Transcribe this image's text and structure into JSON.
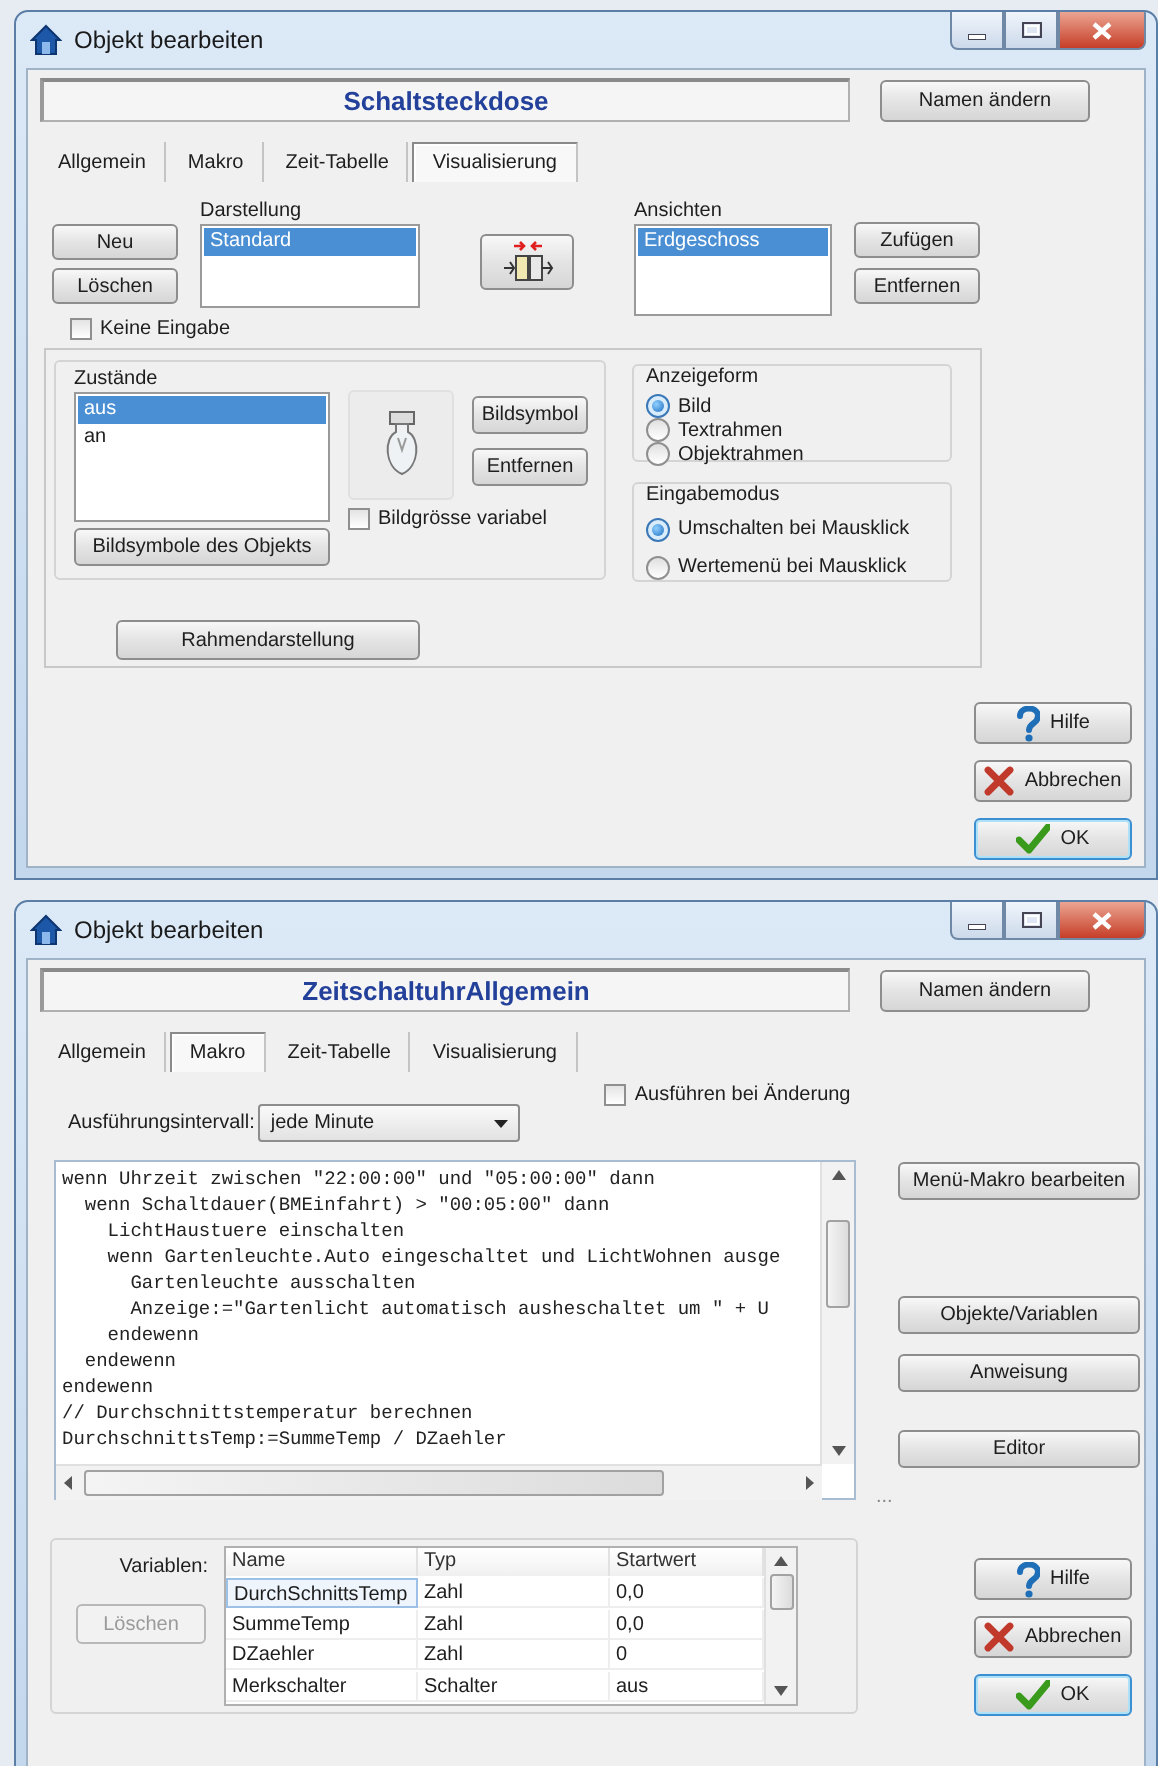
{
  "windows": [
    {
      "kind": "visualisierung",
      "title": "Objekt bearbeiten",
      "object_name": "Schaltsteckdose",
      "rename_button": "Namen ändern",
      "tabs": [
        {
          "label": "Allgemein",
          "selected": false
        },
        {
          "label": "Makro",
          "selected": false
        },
        {
          "label": "Zeit-Tabelle",
          "selected": false
        },
        {
          "label": "Visualisierung",
          "selected": true
        }
      ],
      "list_buttons": [
        "Neu",
        "Löschen"
      ],
      "darstellung": {
        "label": "Darstellung",
        "items": [
          {
            "text": "Standard",
            "selected": true
          }
        ]
      },
      "ansichten": {
        "label": "Ansichten",
        "items": [
          {
            "text": "Erdgeschoss",
            "selected": true
          }
        ]
      },
      "view_buttons": [
        "Zufügen",
        "Entfernen"
      ],
      "no_input": {
        "label": "Keine Eingabe",
        "checked": false
      },
      "states": {
        "label": "Zustände",
        "items": [
          {
            "text": "aus",
            "selected": true
          },
          {
            "text": "an",
            "selected": false
          }
        ],
        "buttons": [
          "Bildsymbol",
          "Entfernen"
        ],
        "variable_size": {
          "label": "Bildgrösse variabel",
          "checked": false
        },
        "object_icons_button": "Bildsymbole des Objekts"
      },
      "display_form": {
        "label": "Anzeigeform",
        "options": [
          {
            "label": "Bild",
            "selected": true
          },
          {
            "label": "Textrahmen",
            "selected": false
          },
          {
            "label": "Objektrahmen",
            "selected": false
          }
        ]
      },
      "input_mode": {
        "label": "Eingabemodus",
        "options": [
          {
            "label": "Umschalten bei Mausklick",
            "selected": true
          },
          {
            "label": "Wertemenü bei Mausklick",
            "selected": false
          }
        ]
      },
      "frame_button": "Rahmendarstellung",
      "footer_buttons": [
        {
          "kind": "help",
          "label": "Hilfe"
        },
        {
          "kind": "cancel",
          "label": "Abbrechen"
        },
        {
          "kind": "ok",
          "label": "OK"
        }
      ]
    },
    {
      "kind": "makro",
      "title": "Objekt bearbeiten",
      "object_name": "ZeitschaltuhrAllgemein",
      "rename_button": "Namen ändern",
      "tabs": [
        {
          "label": "Allgemein",
          "selected": false
        },
        {
          "label": "Makro",
          "selected": true
        },
        {
          "label": "Zeit-Tabelle",
          "selected": false
        },
        {
          "label": "Visualisierung",
          "selected": false
        }
      ],
      "run_on_change": {
        "label": "Ausführen bei Änderung",
        "checked": false
      },
      "interval": {
        "label": "Ausführungsintervall:",
        "value": "jede Minute"
      },
      "code_lines": [
        "wenn Uhrzeit zwischen \"22:00:00\" und \"05:00:00\" dann",
        "  wenn Schaltdauer(BMEinfahrt) > \"00:05:00\" dann",
        "    LichtHaustuere einschalten",
        "    wenn Gartenleuchte.Auto eingeschaltet und LichtWohnen ausge",
        "      Gartenleuchte ausschalten",
        "      Anzeige:=\"Gartenlicht automatisch ausheschaltet um \" + U",
        "    endewenn",
        "  endewenn",
        "endewenn",
        "// Durchschnittstemperatur berechnen",
        "DurchschnittsTemp:=SummeTemp / DZaehler"
      ],
      "side_buttons": [
        "Menü-Makro bearbeiten",
        "Objekte/Variablen",
        "Anweisung",
        "Editor"
      ],
      "ellipsis": "...",
      "variables": {
        "label": "Variablen:",
        "delete_button": {
          "label": "Löschen",
          "disabled": true
        },
        "columns": [
          "Name",
          "Typ",
          "Startwert"
        ],
        "rows": [
          {
            "cells": [
              "DurchSchnittsTemp",
              "Zahl",
              "0,0"
            ],
            "selected": true
          },
          {
            "cells": [
              "SummeTemp",
              "Zahl",
              "0,0"
            ],
            "selected": false
          },
          {
            "cells": [
              "DZaehler",
              "Zahl",
              "0"
            ],
            "selected": false
          },
          {
            "cells": [
              "Merkschalter",
              "Schalter",
              "aus"
            ],
            "selected": false
          }
        ]
      },
      "footer_buttons": [
        {
          "kind": "help",
          "label": "Hilfe"
        },
        {
          "kind": "cancel",
          "label": "Abbrechen"
        },
        {
          "kind": "ok",
          "label": "OK"
        }
      ]
    }
  ]
}
